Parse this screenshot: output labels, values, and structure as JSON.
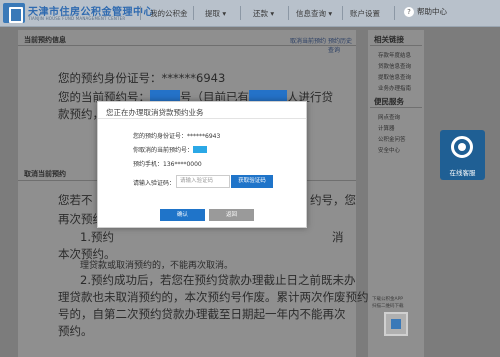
{
  "header": {
    "brand": "天津市住房公积金管理中心",
    "brand_sub": "TIANJIN HOUSE FUND MANAGEMENT CENTER",
    "nav": [
      "我的公积金",
      "提取",
      "还款",
      "信息查询",
      "账户设置"
    ],
    "nav_arrow": "▾",
    "help": "帮助中心",
    "help_icon": "?"
  },
  "main": {
    "tab_title": "当前预约信息",
    "tab_links": [
      "取消当前预约",
      "预约历史查询"
    ],
    "lines": {
      "l1": "您的预约身份证号：******6943",
      "l2a": "您的当前预约号：",
      "l2b": "号（目前已有",
      "l2c": "人进行贷",
      "l3": "款预约，并",
      "p1a": "您若不",
      "p1b": "约号，您",
      "p2": "再次预约。",
      "p3a": "1.预约",
      "p3b": "消",
      "p4": "本次预约。",
      "p5": "理贷款或取消预约的，不能再次取消。",
      "p6": "2.预约成功后，若您在预约贷款办理截止日之前既未办",
      "p7": "理贷款也未取消预约的，本次预约号作废。累计两次作废预约",
      "p8": "号的，自第二次预约贷款办理截至日期起一年内不能再次",
      "p9": "预约。"
    },
    "section_title": "取消当前预约"
  },
  "sidebar": {
    "h1": "相关链接",
    "links1": [
      "存款年度结息",
      "贷款信息查询",
      "提取信息查询",
      "业务办理指南"
    ],
    "h2": "便民服务",
    "links2": [
      "网点查询",
      "计算器",
      "公积金问答",
      "安全中心"
    ],
    "qr_label": "下载公积金APP",
    "qr_label2": "扫描二维码下载"
  },
  "service": {
    "label": "在线客服"
  },
  "modal": {
    "title": "您正在办理取消贷款预约业务",
    "id_label": "您的预约身份证号：******6943",
    "num_label": "你取消的当前预约号：",
    "phone_label": "预约手机：136****0000",
    "code_label": "请输入验证码：",
    "code_placeholder": "请输入验证码",
    "get_code": "获取验证码",
    "ok": "确认",
    "cancel": "返回"
  }
}
